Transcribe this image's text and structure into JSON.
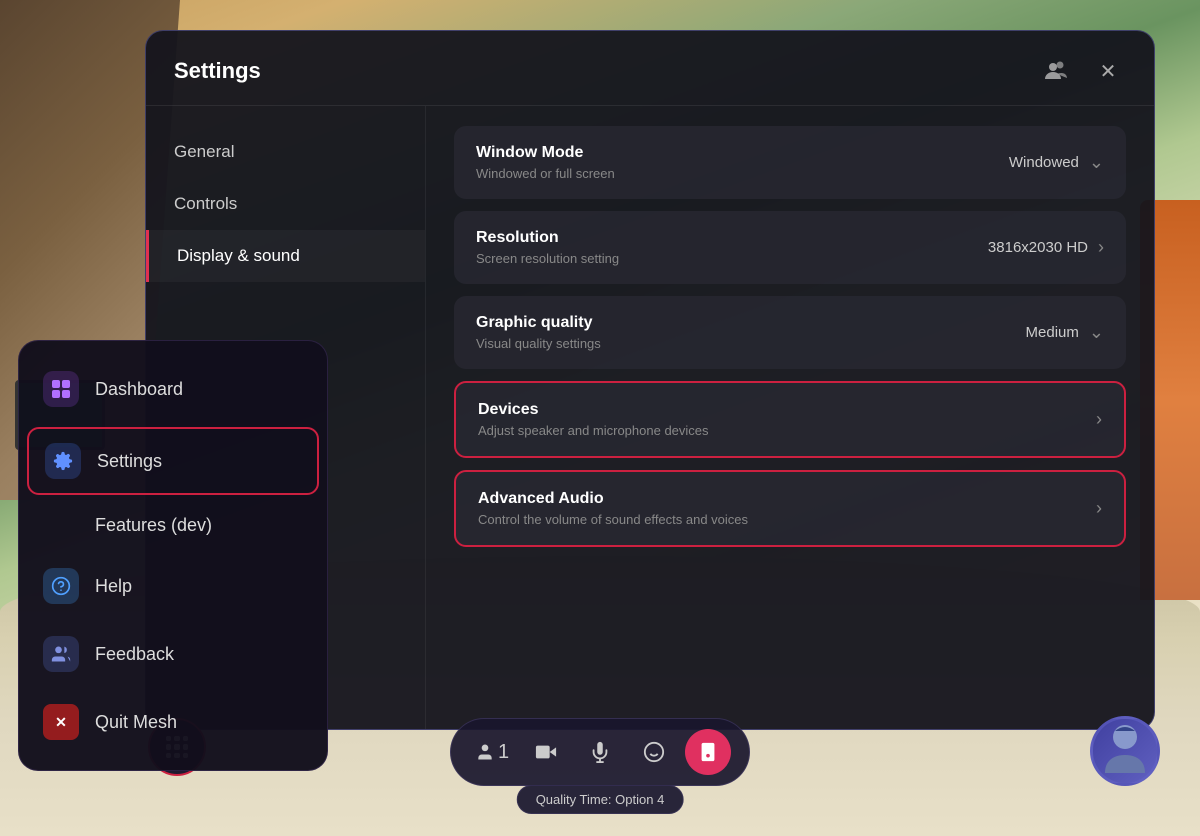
{
  "app": {
    "title": "Settings",
    "quality_badge": "Quality Time: Option 4"
  },
  "settings_panel": {
    "title": "Settings",
    "close_label": "✕",
    "sidebar": {
      "items": [
        {
          "id": "general",
          "label": "General",
          "active": false
        },
        {
          "id": "controls",
          "label": "Controls",
          "active": false
        },
        {
          "id": "display-sound",
          "label": "Display & sound",
          "active": true
        }
      ]
    },
    "content": {
      "rows": [
        {
          "id": "window-mode",
          "title": "Window Mode",
          "subtitle": "Windowed or full screen",
          "value": "Windowed",
          "type": "dropdown",
          "outlined": false
        },
        {
          "id": "resolution",
          "title": "Resolution",
          "subtitle": "Screen resolution setting",
          "value": "3816x2030 HD",
          "type": "navigate",
          "outlined": false
        },
        {
          "id": "graphic-quality",
          "title": "Graphic quality",
          "subtitle": "Visual quality settings",
          "value": "Medium",
          "type": "dropdown",
          "outlined": false
        },
        {
          "id": "devices",
          "title": "Devices",
          "subtitle": "Adjust speaker and microphone devices",
          "value": "",
          "type": "navigate",
          "outlined": true
        },
        {
          "id": "advanced-audio",
          "title": "Advanced Audio",
          "subtitle": "Control the volume of sound effects and voices",
          "value": "",
          "type": "navigate",
          "outlined": true
        }
      ]
    }
  },
  "side_menu": {
    "items": [
      {
        "id": "dashboard",
        "label": "Dashboard",
        "icon": "⊞",
        "icon_type": "purple",
        "active": false
      },
      {
        "id": "settings",
        "label": "Settings",
        "icon": "⚙",
        "icon_type": "gear",
        "active": true
      },
      {
        "id": "features-dev",
        "label": "Features (dev)",
        "icon": "",
        "icon_type": "hidden",
        "active": false,
        "partial": true
      },
      {
        "id": "help",
        "label": "Help",
        "icon": "?",
        "icon_type": "help",
        "active": false
      },
      {
        "id": "feedback",
        "label": "Feedback",
        "icon": "👥",
        "icon_type": "feedback",
        "active": false
      },
      {
        "id": "quit",
        "label": "Quit Mesh",
        "icon": "✕",
        "icon_type": "quit",
        "active": false
      }
    ]
  },
  "toolbar": {
    "user_count": "1",
    "buttons": [
      {
        "id": "camera",
        "icon": "📷",
        "label": "camera",
        "active": false
      },
      {
        "id": "mic",
        "icon": "🎤",
        "label": "microphone",
        "active": false
      },
      {
        "id": "emoji",
        "icon": "😊",
        "label": "emoji",
        "active": false
      },
      {
        "id": "active-btn",
        "icon": "📱",
        "label": "active",
        "active": true
      }
    ]
  },
  "icons": {
    "chevron_down": "⌄",
    "chevron_right": "›",
    "grid": "grid",
    "close": "✕",
    "profile": "👤"
  }
}
